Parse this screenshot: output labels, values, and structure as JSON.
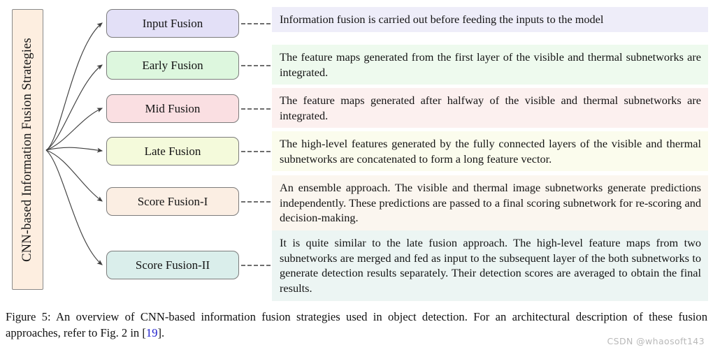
{
  "figure": {
    "root_label": "CNN-based Information Fusion Strategies",
    "root_fill": "#fdeee0",
    "root_border": "#8a8a8a",
    "connector_color": "#4d4d4d",
    "dash_color": "#6e6e6e",
    "nodes": [
      {
        "id": "input-fusion",
        "label": "Input Fusion",
        "box_fill": "#e3e0f7",
        "box_border": "#7c7c7c",
        "panel_fill": "#eeedf9",
        "description": "Information fusion is carried out before feeding the inputs to the model"
      },
      {
        "id": "early-fusion",
        "label": "Early Fusion",
        "box_fill": "#ddf7de",
        "box_border": "#7c7c7c",
        "panel_fill": "#eefaee",
        "description": "The feature maps generated from the first layer of the visible and thermal subnetworks are integrated."
      },
      {
        "id": "mid-fusion",
        "label": "Mid Fusion",
        "box_fill": "#fadfe2",
        "box_border": "#7c7c7c",
        "panel_fill": "#fcf0ef",
        "description": "The feature maps generated after halfway of the visible and thermal subnetworks are integrated."
      },
      {
        "id": "late-fusion",
        "label": "Late Fusion",
        "box_fill": "#f4fadb",
        "box_border": "#7c7c7c",
        "panel_fill": "#fbfced",
        "description": "The high-level features generated by the fully connected layers of the visible and thermal subnetworks are concatenated to form a long feature vector."
      },
      {
        "id": "score-fusion-i",
        "label": "Score Fusion-I",
        "box_fill": "#fbeee3",
        "box_border": "#7c7c7c",
        "panel_fill": "#fbf6ef",
        "description": "An ensemble approach. The visible and thermal image subnetworks generate predictions independently. These predictions are passed to a final scoring subnetwork for re-scoring and decision-making."
      },
      {
        "id": "score-fusion-ii",
        "label": "Score Fusion-II",
        "box_fill": "#daeeeb",
        "box_border": "#7c7c7c",
        "panel_fill": "#ecf5f3",
        "description": "It is quite similar to the late fusion approach. The high-level feature maps from two subnetworks are merged and fed as input to the subsequent layer of the both subnetworks to generate detection results separately. Their detection scores are averaged to obtain the final results."
      }
    ]
  },
  "caption": {
    "text_before": "Figure 5:  An overview of CNN-based information fusion strategies used in object detection.  For an architectural description of these fusion approaches, refer to Fig. 2 in  [",
    "reference": "19",
    "text_after": "]."
  },
  "watermark": {
    "text": "CSDN @whaosoft143"
  }
}
